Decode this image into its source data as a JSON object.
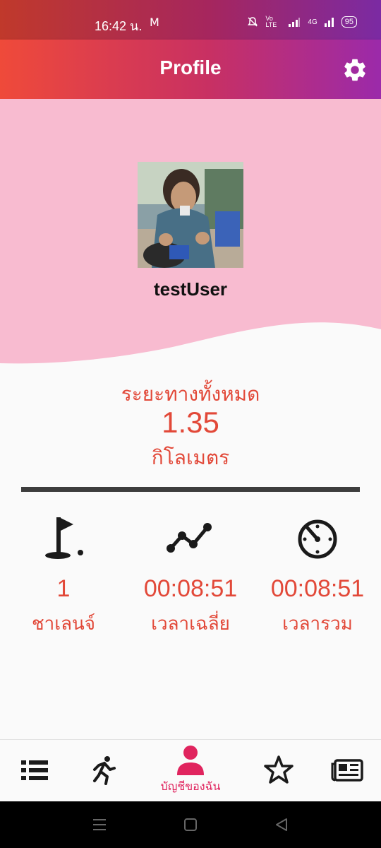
{
  "status_bar": {
    "time": "16:42 น.",
    "mail_icon": "M",
    "network": "Vo LTE",
    "network2": "4G",
    "battery": "95"
  },
  "appbar": {
    "title": "Profile",
    "settings_icon": "gear-icon"
  },
  "profile": {
    "username": "testUser",
    "hero_color": "#f8bbd0"
  },
  "distance": {
    "label": "ระยะทางทั้งหมด",
    "value": "1.35",
    "unit": "กิโลเมตร"
  },
  "stats": [
    {
      "icon": "golf-flag-icon",
      "value": "1",
      "label": "ชาเลนจ์"
    },
    {
      "icon": "trend-line-icon",
      "value": "00:08:51",
      "label": "เวลาเฉลี่ย"
    },
    {
      "icon": "timer-icon",
      "value": "00:08:51",
      "label": "เวลารวม"
    }
  ],
  "bottom_nav": {
    "active_label": "บัญชีของฉัน",
    "items": [
      "list-icon",
      "runner-icon",
      "account-icon",
      "star-icon",
      "news-icon"
    ]
  },
  "colors": {
    "accent": "#e24838",
    "active_nav": "#e0245e"
  }
}
